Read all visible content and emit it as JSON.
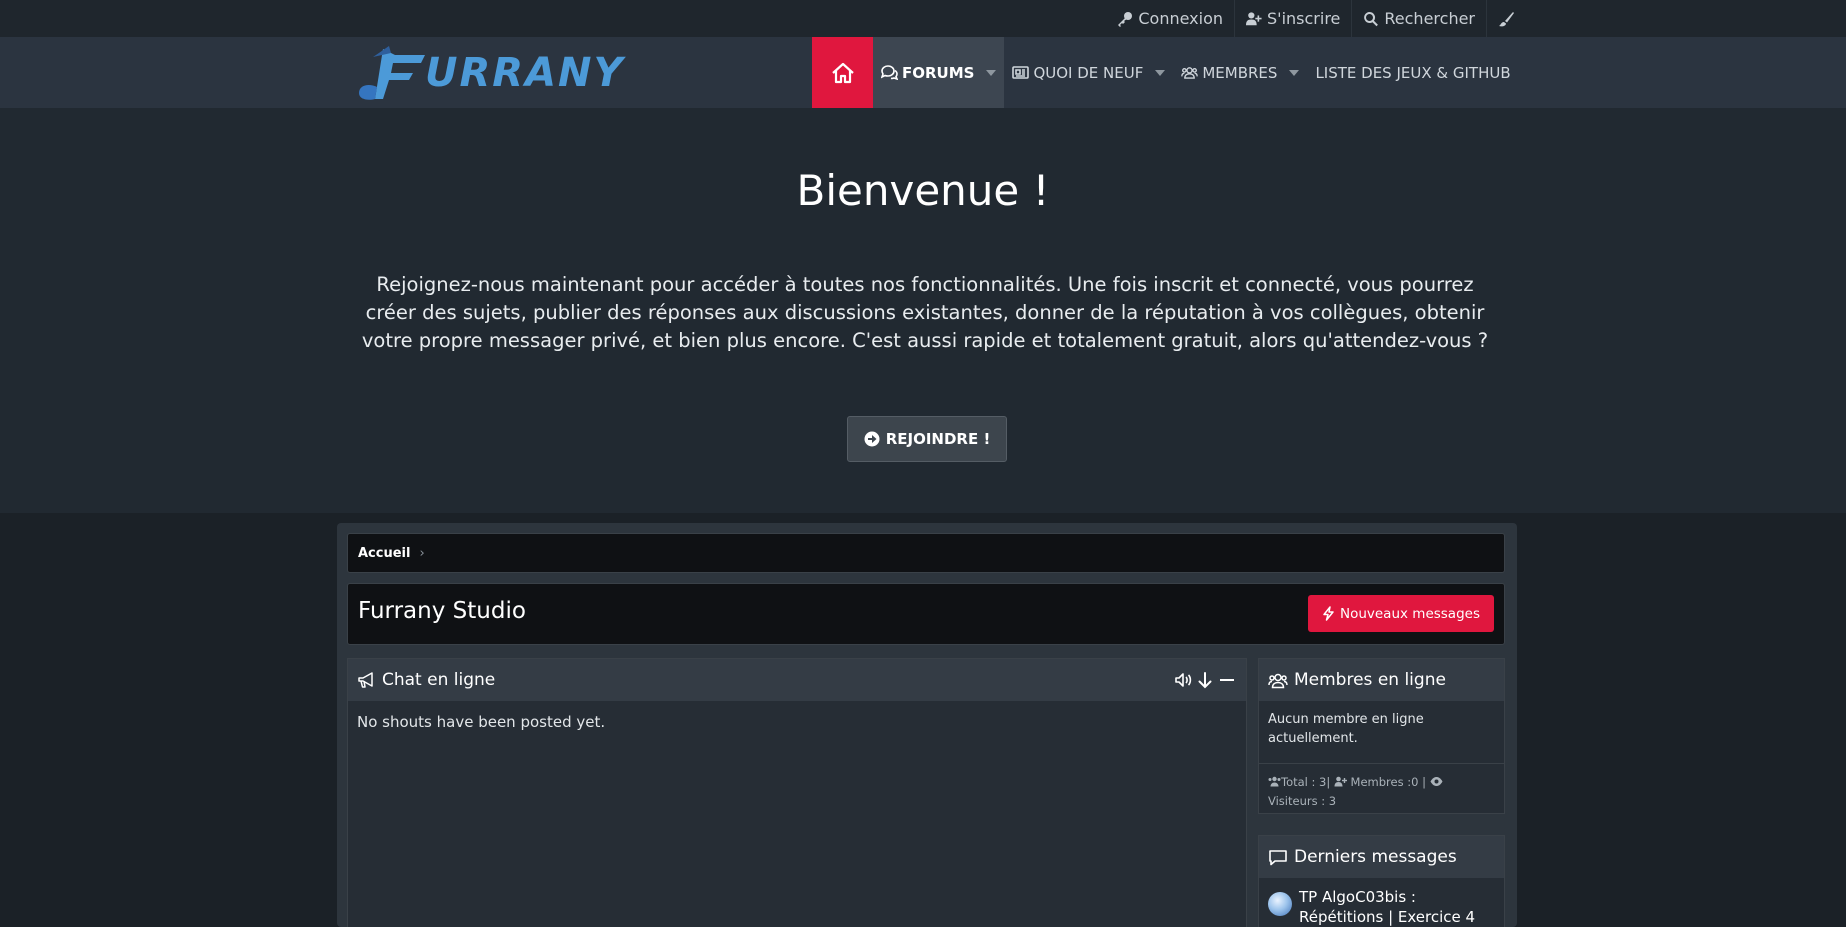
{
  "topbar": {
    "login": "Connexion",
    "register": "S'inscrire",
    "search": "Rechercher"
  },
  "logo": {
    "text": "URRANY"
  },
  "nav": {
    "forums": "FORUMS",
    "whats_new": "QUOI DE NEUF",
    "members": "MEMBRES",
    "games": "LISTE DES JEUX & GITHUB"
  },
  "hero": {
    "title": "Bienvenue !",
    "text": "Rejoignez-nous maintenant pour accéder à toutes nos fonctionnalités. Une fois inscrit et connecté, vous pourrez créer des sujets, publier des réponses aux discussions existantes, donner de la réputation à vos collègues, obtenir votre propre messager privé, et bien plus encore. C'est aussi rapide et totalement gratuit, alors qu'attendez-vous ?",
    "join_label": "REJOINDRE !"
  },
  "breadcrumb": {
    "home": "Accueil"
  },
  "page": {
    "title": "Furrany Studio",
    "new_messages": "Nouveaux messages"
  },
  "chat": {
    "title": "Chat en ligne",
    "empty": "No shouts have been posted yet."
  },
  "online": {
    "title": "Membres en ligne",
    "message": "Aucun membre en ligne actuellement.",
    "total": "Total : 3|",
    "members": "Membres :0 |",
    "visitors": "Visiteurs : 3"
  },
  "latest": {
    "title": "Derniers messages",
    "post_title": "TP AlgoC03bis : Répétitions | Exercice 4"
  },
  "colors": {
    "accent_red": "#e0173e",
    "nav_bg": "#2b3440",
    "hero_bg": "#212931",
    "logo_blue": "#4c9ad8"
  }
}
